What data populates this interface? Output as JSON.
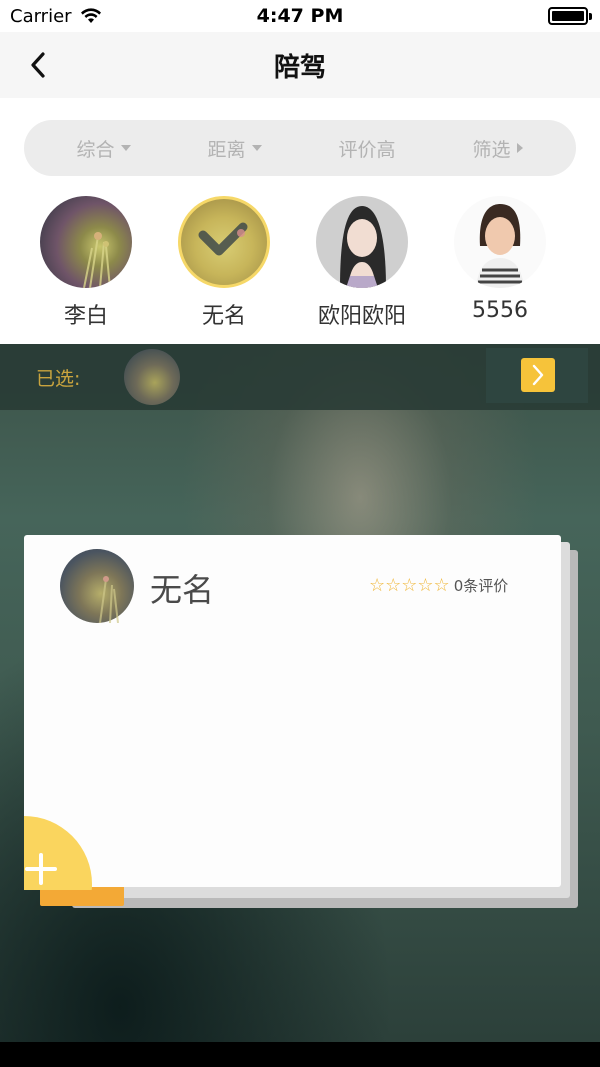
{
  "status_bar": {
    "carrier": "Carrier",
    "time": "4:47 PM"
  },
  "nav": {
    "title": "陪驾"
  },
  "filters": [
    {
      "label": "综合",
      "icon": "caret-down-icon"
    },
    {
      "label": "距离",
      "icon": "caret-down-icon"
    },
    {
      "label": "评价高",
      "icon": ""
    },
    {
      "label": "筛选",
      "icon": "caret-right-icon"
    }
  ],
  "coaches": [
    {
      "name": "李白"
    },
    {
      "name": "无名",
      "selected": true
    },
    {
      "name": "欧阳欧阳"
    },
    {
      "name": "5556"
    }
  ],
  "selected_bar": {
    "label": "已选:"
  },
  "card": {
    "name": "无名",
    "stars": "☆☆☆☆☆",
    "rating_value": 0,
    "review_count": "0条评价"
  },
  "colors": {
    "accent": "#f6c33a",
    "gold_text": "#c9a43e",
    "add_button": "#fad55e",
    "star": "#f0b83c"
  }
}
